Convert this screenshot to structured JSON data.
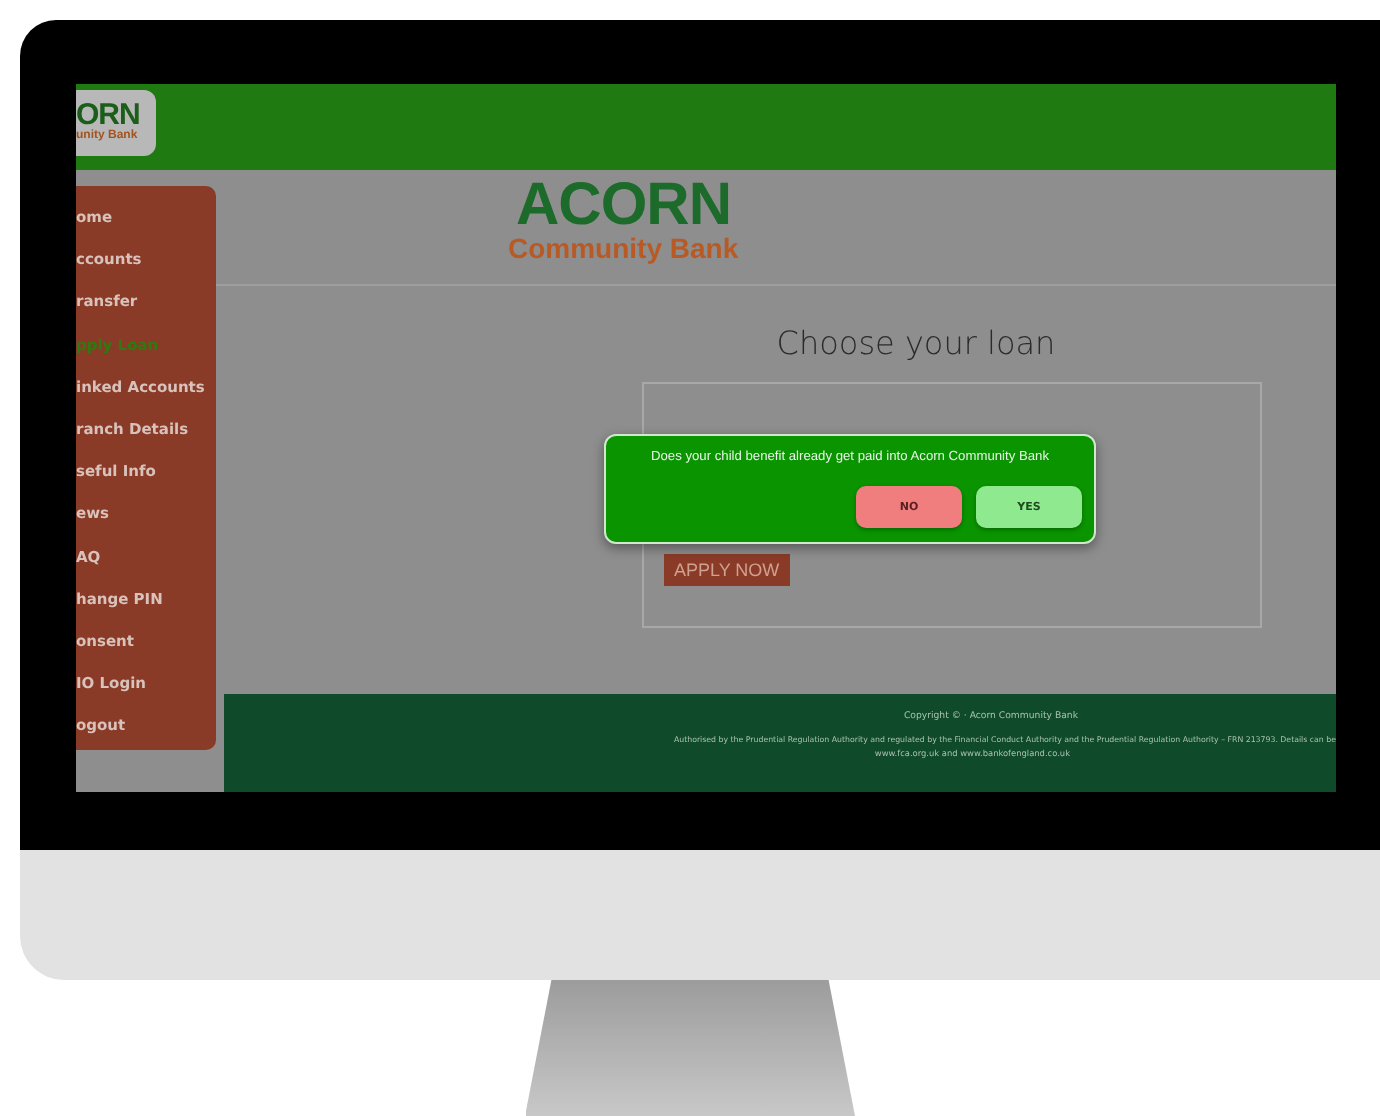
{
  "header": {
    "logo_top": "ORN",
    "logo_bottom": "unity Bank"
  },
  "sidebar": {
    "items": [
      {
        "label": "ome",
        "selected": false
      },
      {
        "label": "ccounts",
        "selected": false
      },
      {
        "label": "ransfer",
        "selected": false
      },
      {
        "label": "pply Loan",
        "selected": true
      },
      {
        "label": "inked Accounts",
        "selected": false
      },
      {
        "label": "ranch Details",
        "selected": false
      },
      {
        "label": "seful Info",
        "selected": false
      },
      {
        "label": "ews",
        "selected": false
      },
      {
        "label": "AQ",
        "selected": false
      },
      {
        "label": "hange PIN",
        "selected": false
      },
      {
        "label": "onsent",
        "selected": false
      },
      {
        "label": "IO Login",
        "selected": false
      },
      {
        "label": "ogout",
        "selected": false
      }
    ]
  },
  "brand": {
    "name": "ACORN",
    "tagline": "Community Bank"
  },
  "page": {
    "title": "Choose your loan",
    "apply_button": "APPLY NOW"
  },
  "dialog": {
    "message": "Does your child benefit already get paid into Acorn Community Bank",
    "buttons": [
      {
        "label": "NO",
        "kind": "decline"
      },
      {
        "label": "YES",
        "kind": "accept"
      }
    ]
  },
  "footer": {
    "copyright": "Copyright © · Acorn Community Bank",
    "legal": "Authorised by the Prudential Regulation Authority and regulated by the Financial Conduct Authority and the Prudential Regulation Authority – FRN 213793. Details can be",
    "links": "www.fca.org.uk and www.bankofengland.co.uk"
  }
}
